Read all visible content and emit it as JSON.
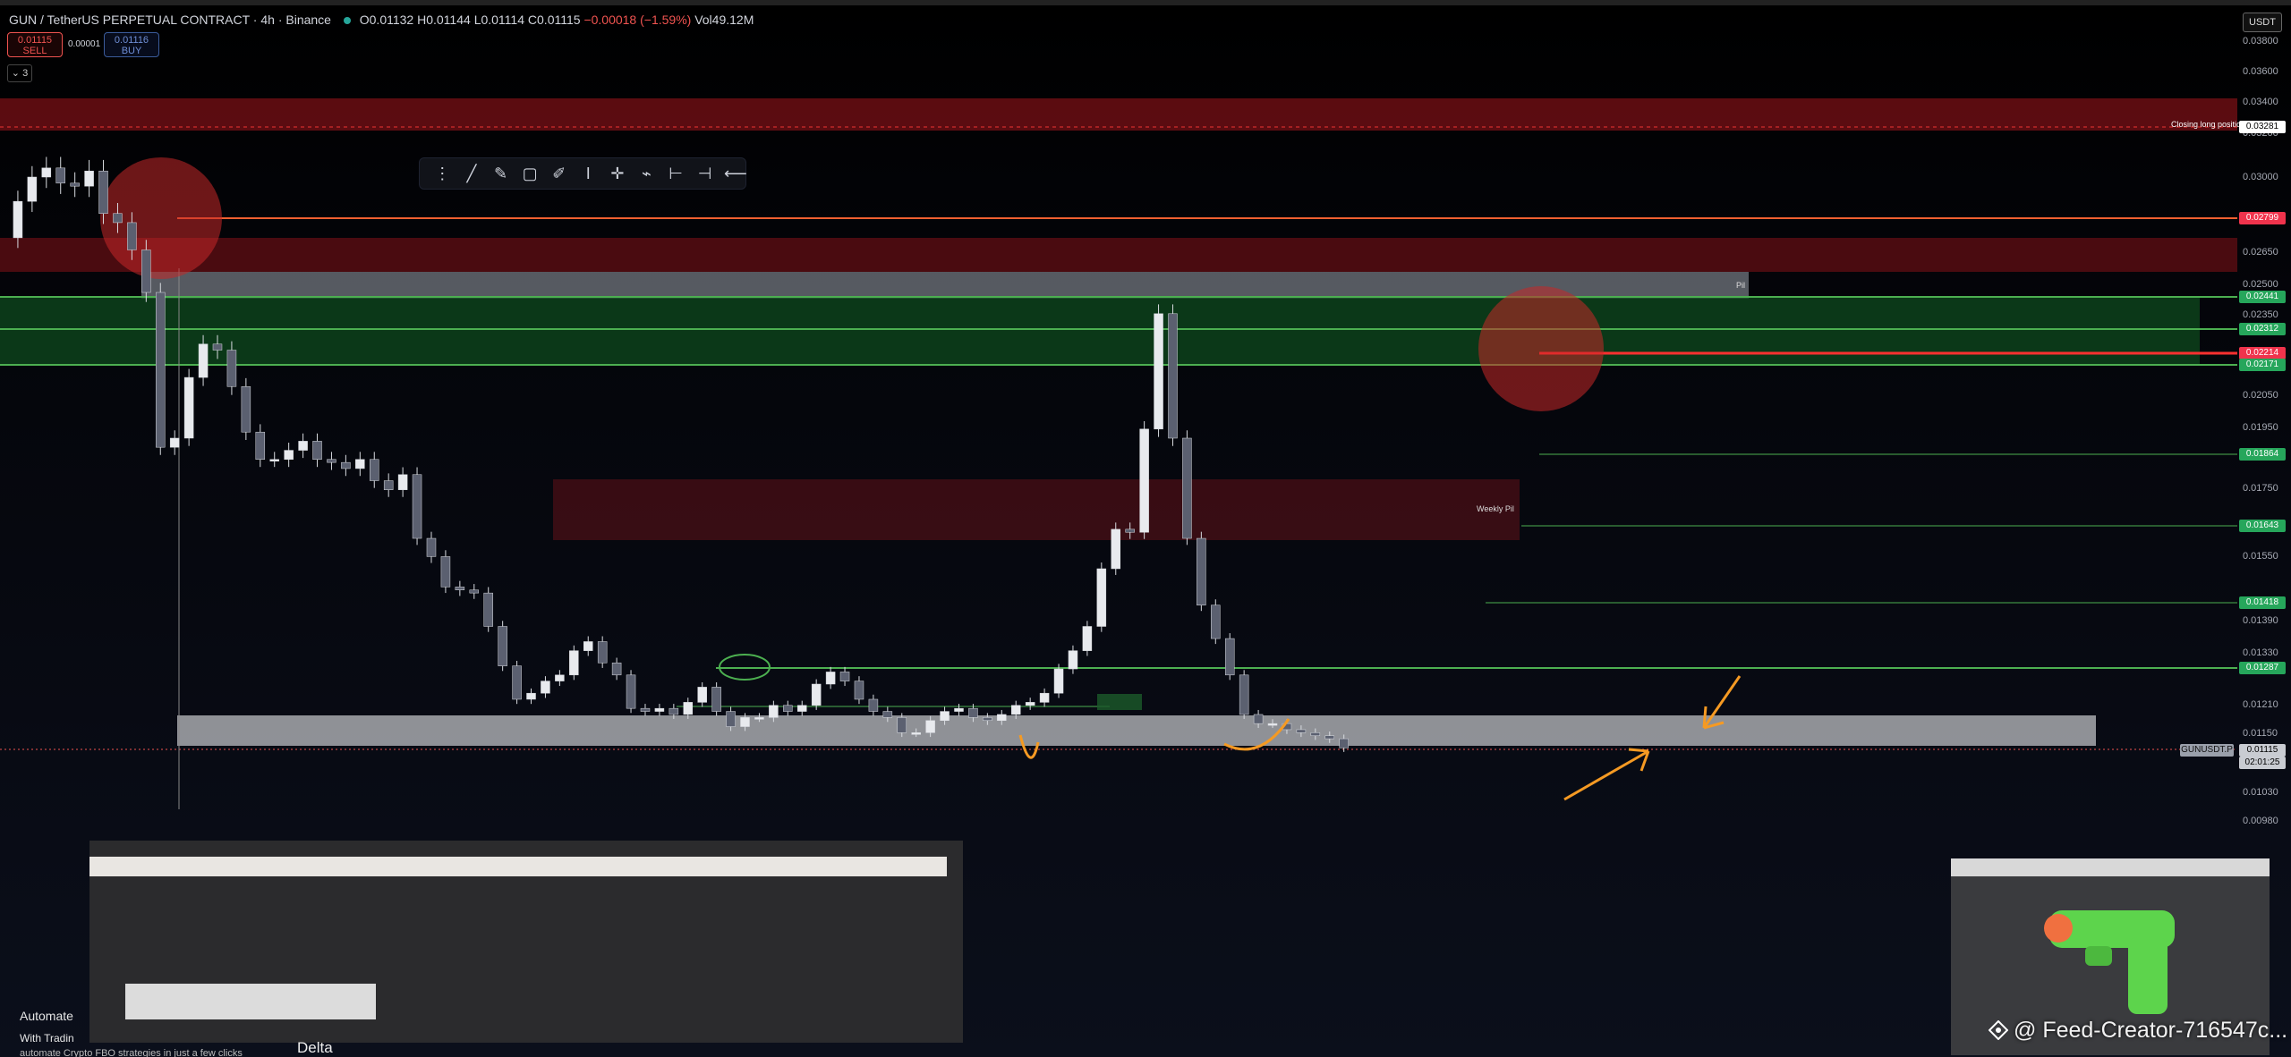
{
  "header": {
    "pair": "GUN / TetherUS PERPETUAL CONTRACT · 4h · Binance",
    "open": "O0.01132",
    "high": "H0.01144",
    "low": "L0.01114",
    "close": "C0.01115",
    "change": "−0.00018 (−1.59%)",
    "volume": "Vol49.12M"
  },
  "trade": {
    "sell_price": "0.01115",
    "sell_label": "SELL",
    "spread": "0.00001",
    "buy_price": "0.01116",
    "buy_label": "BUY",
    "indicators_count": "3"
  },
  "currency_selector": "USDT",
  "price_axis": {
    "ticks": [
      "0.03800",
      "0.03600",
      "0.03400",
      "0.03200",
      "0.03000",
      "0.02650",
      "0.02500",
      "0.02350",
      "0.02050",
      "0.01950",
      "0.01750",
      "0.01550",
      "0.01390",
      "0.01330",
      "0.01210",
      "0.01150",
      "0.01030",
      "0.00980"
    ],
    "labels": [
      {
        "value": "0.03281",
        "color": "#ffffff",
        "text_color": "#000"
      },
      {
        "value": "0.02799",
        "color": "#f0334c",
        "text_color": "#fff"
      },
      {
        "value": "0.02441",
        "color": "#26a65b",
        "text_color": "#fff"
      },
      {
        "value": "0.02312",
        "color": "#26a65b",
        "text_color": "#fff"
      },
      {
        "value": "0.02214",
        "color": "#f0334c",
        "text_color": "#fff"
      },
      {
        "value": "0.02171",
        "color": "#26a65b",
        "text_color": "#fff"
      },
      {
        "value": "0.01864",
        "color": "#26a65b",
        "text_color": "#fff"
      },
      {
        "value": "0.01643",
        "color": "#26a65b",
        "text_color": "#fff"
      },
      {
        "value": "0.01418",
        "color": "#26a65b",
        "text_color": "#fff"
      },
      {
        "value": "0.01287",
        "color": "#26a65b",
        "text_color": "#fff"
      }
    ],
    "current_price": "0.01115",
    "countdown": "02:01:25",
    "symbol_tag": "GUNUSDT.P"
  },
  "annotations": {
    "closing_long": "Closing long position",
    "pil": "Pil",
    "weekly_pil": "Weekly Pil"
  },
  "chart_data": {
    "type": "candlestick",
    "x": [
      0,
      10,
      20,
      30,
      40,
      50,
      60,
      70,
      80,
      90,
      100,
      110,
      120,
      130,
      140,
      150,
      160,
      170,
      180,
      190,
      200,
      210,
      220,
      230,
      240,
      250,
      260,
      270,
      280,
      290,
      300,
      310,
      320,
      330,
      340,
      350,
      360,
      370,
      380,
      390,
      400,
      410,
      420,
      430,
      440,
      450,
      460,
      470,
      480,
      490,
      500,
      510,
      520,
      530,
      540,
      550,
      560,
      570,
      580,
      590,
      600,
      610,
      620,
      630,
      640,
      650,
      660,
      670,
      680,
      690,
      700,
      710,
      720,
      730,
      740,
      750,
      760,
      770,
      780,
      790,
      800,
      810,
      820,
      830,
      840,
      850,
      860,
      870,
      880,
      890,
      900,
      910,
      920,
      930,
      940,
      950,
      960,
      970,
      980,
      990,
      1000,
      1010,
      1020,
      1030,
      1040,
      1050,
      1060,
      1070,
      1080,
      1090,
      1100,
      1110,
      1120,
      1130,
      1140,
      1150,
      1160,
      1170,
      1180,
      1190
    ],
    "close": [
      0.028,
      0.0292,
      0.03,
      0.0303,
      0.0298,
      0.0297,
      0.0302,
      0.0288,
      0.0285,
      0.0276,
      0.0262,
      0.0211,
      0.0214,
      0.0234,
      0.0245,
      0.0243,
      0.0231,
      0.0216,
      0.0207,
      0.0207,
      0.021,
      0.0213,
      0.0207,
      0.0206,
      0.0204,
      0.0207,
      0.02,
      0.0197,
      0.0202,
      0.0181,
      0.0175,
      0.0165,
      0.0164,
      0.0163,
      0.0152,
      0.0139,
      0.0128,
      0.013,
      0.0134,
      0.0136,
      0.0144,
      0.0147,
      0.014,
      0.0136,
      0.0125,
      0.0124,
      0.0125,
      0.0123,
      0.0127,
      0.0132,
      0.0124,
      0.0119,
      0.0122,
      0.0122,
      0.0126,
      0.0124,
      0.0126,
      0.0133,
      0.0137,
      0.0134,
      0.0128,
      0.0124,
      0.0122,
      0.0117,
      0.0117,
      0.0121,
      0.0124,
      0.0125,
      0.0122,
      0.0121,
      0.0123,
      0.0126,
      0.0127,
      0.013,
      0.0138,
      0.0144,
      0.0152,
      0.0171,
      0.0184,
      0.0183,
      0.0217,
      0.0255,
      0.0214,
      0.0181,
      0.0159,
      0.0148,
      0.0136,
      0.0123,
      0.012,
      0.012,
      0.0118,
      0.0117,
      0.0116,
      0.0115,
      0.0112
    ]
  }
}
